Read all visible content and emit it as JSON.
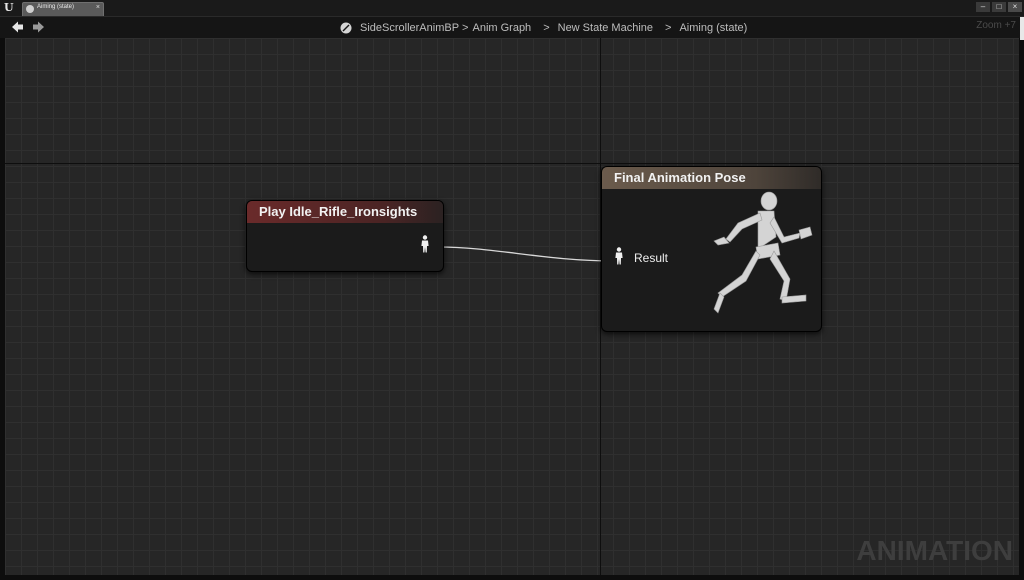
{
  "window": {
    "tab_title": "Aiming (state)",
    "tab_close": "×",
    "controls": {
      "minimize": "–",
      "maximize": "□",
      "close": "×"
    }
  },
  "navigation": {
    "back_icon": "arrow-left-icon",
    "forward_icon": "arrow-right-icon",
    "breadcrumbs": [
      {
        "label": "SideScrollerAnimBP",
        "icon": "blueprint-icon"
      },
      {
        "label": "Anim Graph"
      },
      {
        "label": "New State Machine"
      },
      {
        "label": "Aiming (state)"
      }
    ],
    "separator": ">",
    "zoom": "Zoom +7"
  },
  "graph": {
    "watermark": "ANIMATION",
    "nodes": {
      "play": {
        "title": "Play Idle_Rifle_Ironsights",
        "output_pin_icon": "pose-pin-icon"
      },
      "final": {
        "title": "Final Animation Pose",
        "input_pin_label": "Result",
        "input_pin_icon": "pose-pin-icon",
        "preview_icon": "running-mannequin-icon"
      }
    }
  },
  "colors": {
    "canvas": "#262626",
    "play_header": "#6a2a2a",
    "final_header": "#6b5b4c",
    "wire": "#d8d8d8"
  }
}
